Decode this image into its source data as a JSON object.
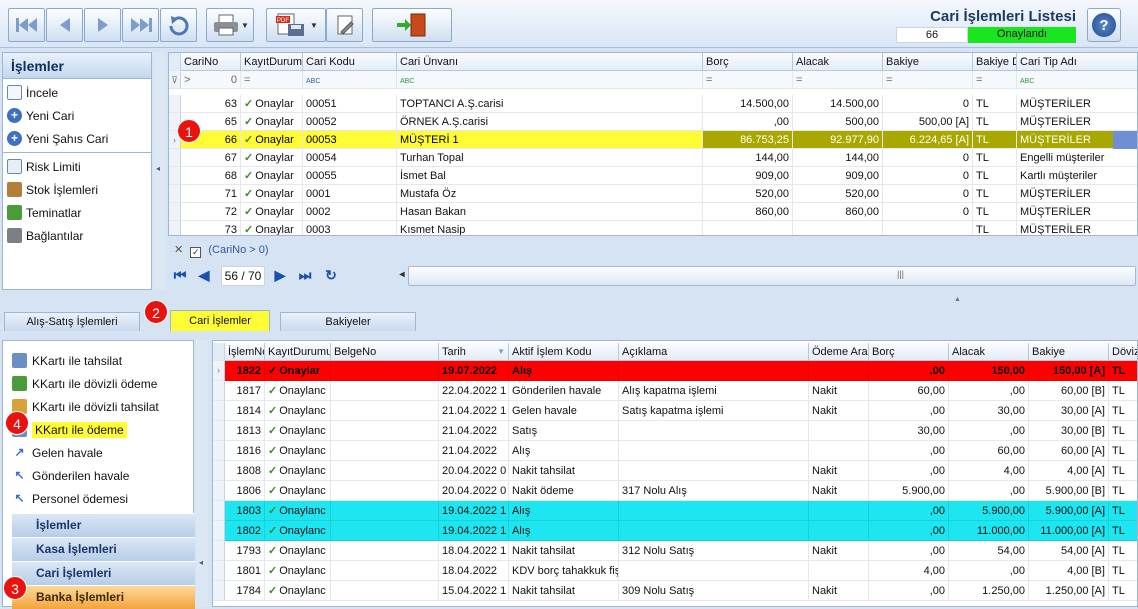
{
  "toolbar": {
    "icons": [
      "first-record-icon",
      "prev-record-icon",
      "next-record-icon",
      "last-record-icon",
      "refresh-icon",
      "print-icon",
      "pdf-export-icon",
      "settings-icon",
      "exit-door-icon"
    ],
    "title": "Cari İşlemleri Listesi",
    "record_count": "66",
    "record_status": "Onaylandı",
    "status_color": "#19e61e"
  },
  "left_panel": {
    "title": "İşlemler",
    "items": [
      {
        "label": "İncele",
        "icon": "document-icon"
      },
      {
        "label": "Yeni Cari",
        "icon": "add-icon"
      },
      {
        "label": "Yeni Şahıs Cari",
        "icon": "add-icon"
      },
      {
        "label": "Risk Limiti",
        "icon": "risk-icon"
      },
      {
        "label": "Stok İşlemleri",
        "icon": "stock-icon"
      },
      {
        "label": "Teminatlar",
        "icon": "collateral-icon"
      },
      {
        "label": "Bağlantılar",
        "icon": "link-icon"
      }
    ]
  },
  "top_grid": {
    "columns": [
      "CariNo",
      "KayıtDurumu",
      "Cari Kodu",
      "Cari Ünvanı",
      "Borç",
      "Alacak",
      "Bakiye",
      "Bakiye D",
      "Cari Tip Adı"
    ],
    "filter_row": {
      "carino": "0",
      "operator": "="
    },
    "rows": [
      {
        "no": "63",
        "status": "Onaylar",
        "code": "00051",
        "name": "TOPTANCI A.Ş.carisi",
        "borc": "14.500,00",
        "alacak": "14.500,00",
        "bakiye": "0",
        "doviz": "TL",
        "tip": "MÜŞTERİLER"
      },
      {
        "no": "65",
        "status": "Onaylar",
        "code": "00052",
        "name": "ÖRNEK A.Ş.carisi",
        "borc": ",00",
        "alacak": "500,00",
        "bakiye": "500,00 [A]",
        "doviz": "TL",
        "tip": "MÜŞTERİLER"
      },
      {
        "no": "66",
        "status": "Onaylar",
        "code": "00053",
        "name": "MÜŞTERİ 1",
        "borc": "86.753,25",
        "alacak": "92.977,90",
        "bakiye": "6.224,65 [A]",
        "doviz": "TL",
        "tip": "MÜŞTERİLER"
      },
      {
        "no": "67",
        "status": "Onaylar",
        "code": "00054",
        "name": "Turhan Topal",
        "borc": "144,00",
        "alacak": "144,00",
        "bakiye": "0",
        "doviz": "TL",
        "tip": "Engelli müşteriler"
      },
      {
        "no": "68",
        "status": "Onaylar",
        "code": "00055",
        "name": "İsmet Bal",
        "borc": "909,00",
        "alacak": "909,00",
        "bakiye": "0",
        "doviz": "TL",
        "tip": "Kartlı müşteriler"
      },
      {
        "no": "71",
        "status": "Onaylar",
        "code": "0001",
        "name": "Mustafa Öz",
        "borc": "520,00",
        "alacak": "520,00",
        "bakiye": "0",
        "doviz": "TL",
        "tip": "MÜŞTERİLER"
      },
      {
        "no": "72",
        "status": "Onaylar",
        "code": "0002",
        "name": "Hasan Bakan",
        "borc": "860,00",
        "alacak": "860,00",
        "bakiye": "0",
        "doviz": "TL",
        "tip": "MÜŞTERİLER"
      },
      {
        "no": "73",
        "status": "Onaylar",
        "code": "0003",
        "name": "Kısmet Nasip",
        "borc": "",
        "alacak": "",
        "bakiye": "",
        "doviz": "TL",
        "tip": "MÜŞTERİLER"
      }
    ],
    "filter_text": "(CariNo > 0)",
    "page": "56 / 70"
  },
  "tabs": [
    "Alış-Satış İşlemleri",
    "Cari İşlemler",
    "Bakiyeler"
  ],
  "badges": [
    "1",
    "2",
    "3",
    "4"
  ],
  "bottom_left": {
    "items": [
      {
        "label": "KKartı ile tahsilat",
        "icon": "credit-card-icon"
      },
      {
        "label": "KKartı ile dövizli ödeme",
        "icon": "currency-icon"
      },
      {
        "label": "KKartı ile dövizli tahsilat",
        "icon": "currency-icon"
      },
      {
        "label": "KKartı ile ödeme",
        "icon": "credit-card-icon"
      },
      {
        "label": "Gelen havale",
        "icon": "incoming-arrow-icon"
      },
      {
        "label": "Gönderilen havale",
        "icon": "outgoing-arrow-icon"
      },
      {
        "label": "Personel ödemesi",
        "icon": "outgoing-arrow-icon"
      }
    ],
    "groups": [
      "İşlemler",
      "Kasa İşlemleri",
      "Cari İşlemleri",
      "Banka İşlemleri"
    ]
  },
  "bottom_grid": {
    "columns": [
      "İşlemNo",
      "KayıtDurumu",
      "BelgeNo",
      "Tarih",
      "Aktif İşlem Kodu",
      "Açıklama",
      "Ödeme Aracı",
      "Borç",
      "Alacak",
      "Bakiye",
      "Döviz"
    ],
    "rows": [
      {
        "no": "1822",
        "status": "Onaylar",
        "belge": "",
        "tarih": "19.07.2022",
        "kod": "Alış",
        "aciklama": "",
        "odeme": "",
        "borc": ",00",
        "alacak": "150,00",
        "bakiye": "150,00 [A]",
        "doviz": "TL",
        "style": "red"
      },
      {
        "no": "1817",
        "status": "Onaylanc",
        "belge": "",
        "tarih": "22.04.2022 1",
        "kod": "Gönderilen havale",
        "aciklama": "Alış kapatma işlemi",
        "odeme": "Nakit",
        "borc": "60,00",
        "alacak": ",00",
        "bakiye": "60,00 [B]",
        "doviz": "TL",
        "style": ""
      },
      {
        "no": "1814",
        "status": "Onaylanc",
        "belge": "",
        "tarih": "21.04.2022 1",
        "kod": "Gelen havale",
        "aciklama": "Satış kapatma işlemi",
        "odeme": "Nakit",
        "borc": ",00",
        "alacak": "30,00",
        "bakiye": "30,00 [A]",
        "doviz": "TL",
        "style": ""
      },
      {
        "no": "1813",
        "status": "Onaylanc",
        "belge": "",
        "tarih": "21.04.2022",
        "kod": "Satış",
        "aciklama": "",
        "odeme": "",
        "borc": "30,00",
        "alacak": ",00",
        "bakiye": "30,00 [B]",
        "doviz": "TL",
        "style": ""
      },
      {
        "no": "1816",
        "status": "Onaylanc",
        "belge": "",
        "tarih": "21.04.2022",
        "kod": "Alış",
        "aciklama": "",
        "odeme": "",
        "borc": ",00",
        "alacak": "60,00",
        "bakiye": "60,00 [A]",
        "doviz": "TL",
        "style": ""
      },
      {
        "no": "1808",
        "status": "Onaylanc",
        "belge": "",
        "tarih": "20.04.2022 0",
        "kod": "Nakit tahsilat",
        "aciklama": "",
        "odeme": "Nakit",
        "borc": ",00",
        "alacak": "4,00",
        "bakiye": "4,00 [A]",
        "doviz": "TL",
        "style": ""
      },
      {
        "no": "1806",
        "status": "Onaylanc",
        "belge": "",
        "tarih": "20.04.2022 0",
        "kod": "Nakit ödeme",
        "aciklama": "317 Nolu Alış",
        "odeme": "Nakit",
        "borc": "5.900,00",
        "alacak": ",00",
        "bakiye": "5.900,00 [B]",
        "doviz": "TL",
        "style": ""
      },
      {
        "no": "1803",
        "status": "Onaylanc",
        "belge": "",
        "tarih": "19.04.2022 1",
        "kod": "Alış",
        "aciklama": "",
        "odeme": "",
        "borc": ",00",
        "alacak": "5.900,00",
        "bakiye": "5.900,00 [A]",
        "doviz": "TL",
        "style": "cyan"
      },
      {
        "no": "1802",
        "status": "Onaylanc",
        "belge": "",
        "tarih": "19.04.2022 1",
        "kod": "Alış",
        "aciklama": "",
        "odeme": "",
        "borc": ",00",
        "alacak": "11.000,00",
        "bakiye": "11.000,00 [A]",
        "doviz": "TL",
        "style": "cyan"
      },
      {
        "no": "1793",
        "status": "Onaylanc",
        "belge": "",
        "tarih": "18.04.2022 1",
        "kod": "Nakit tahsilat",
        "aciklama": "312 Nolu Satış",
        "odeme": "Nakit",
        "borc": ",00",
        "alacak": "54,00",
        "bakiye": "54,00 [A]",
        "doviz": "TL",
        "style": ""
      },
      {
        "no": "1801",
        "status": "Onaylanc",
        "belge": "",
        "tarih": "18.04.2022",
        "kod": "KDV borç tahakkuk fişi",
        "aciklama": "",
        "odeme": "",
        "borc": "4,00",
        "alacak": ",00",
        "bakiye": "4,00 [B]",
        "doviz": "TL",
        "style": ""
      },
      {
        "no": "1784",
        "status": "Onaylanc",
        "belge": "",
        "tarih": "15.04.2022 1",
        "kod": "Nakit tahsilat",
        "aciklama": "309 Nolu Satış",
        "odeme": "Nakit",
        "borc": ",00",
        "alacak": "1.250,00",
        "bakiye": "1.250,00 [A]",
        "doviz": "TL",
        "style": ""
      }
    ]
  },
  "colors": {
    "highlight": "#fffc33",
    "selected_row": "#a8a800",
    "red_row": "#ff0000",
    "cyan_row": "#1ee6f0",
    "badge": "#e8130f"
  }
}
